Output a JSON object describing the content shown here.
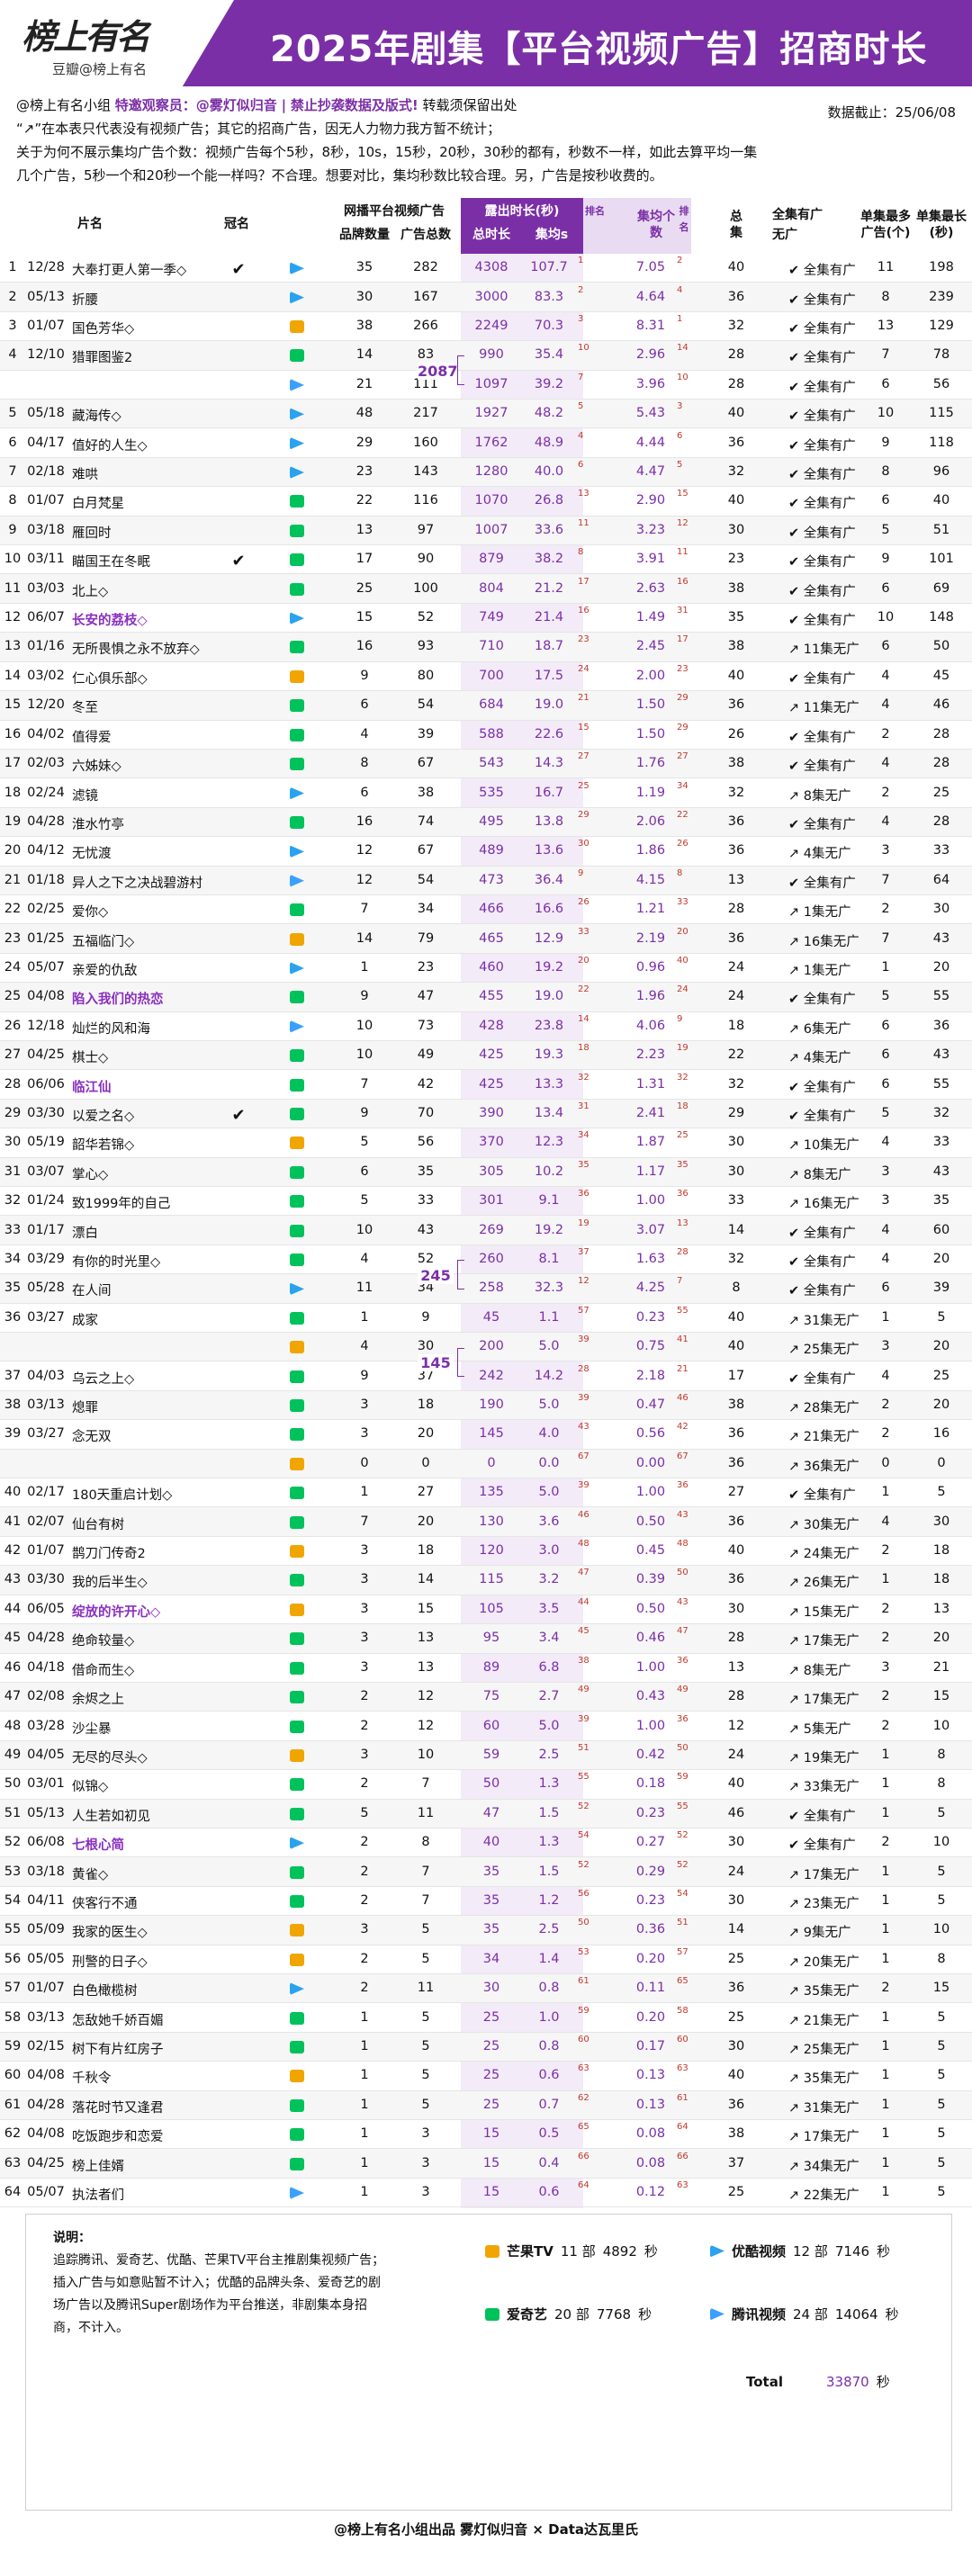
{
  "header": {
    "logo": "榜上有名",
    "logo_sub": "豆瓣@榜上有名",
    "title": "2025年剧集【平台视频广告】招商时长"
  },
  "notes": {
    "line1a": "@榜上有名小组 ",
    "line1b": "特邀观察员：",
    "line1c": "@雾灯似归音",
    "line1d": "|",
    "line1e": "禁止抄袭数据及版式!",
    "line1f": " 转载须保留出处",
    "line2": "“↗”在本表只代表没有视频广告；其它的招商广告，因无人力物力我方暂不统计；",
    "line3": "关于为何不展示集均广告个数：视频广告每个5秒，8秒，10s，15秒，20秒，30秒的都有，秒数不一样，如此去算平均一集",
    "line4": "几个广告，5秒一个和20秒一个能一样吗？不合理。想要对比，集均秒数比较合理。另，广告是按秒收费的。"
  },
  "date": "数据截止：25/06/08",
  "columns": {
    "name": "片名",
    "crown": "冠名",
    "group": "网播平台视频广告",
    "brands": "品牌数量",
    "ads": "广告总数",
    "expo": "露出时长(秒)",
    "total": "总时长",
    "per_ep": "集均s",
    "rank": "排名",
    "avg_cnt": "集均个数",
    "eps": "总集",
    "full": "全集有广",
    "none": "无广",
    "max_ads": "单集最多广告(个)",
    "max_sec": "单集最长(秒)"
  },
  "rows": [
    [
      "1",
      "12/28",
      "大奉打更人第一季◇",
      "✔",
      "yk",
      "35",
      "282",
      "4308",
      "107.7",
      "1",
      "7.05",
      "2",
      "40",
      "全集有广",
      "11",
      "198"
    ],
    [
      "2",
      "05/13",
      "折腰",
      "",
      "yk",
      "30",
      "167",
      "3000",
      "83.3",
      "2",
      "4.64",
      "4",
      "36",
      "全集有广",
      "8",
      "239"
    ],
    [
      "3",
      "01/07",
      "国色芳华◇",
      "",
      "mg",
      "38",
      "266",
      "2249",
      "70.3",
      "3",
      "8.31",
      "1",
      "32",
      "全集有广",
      "13",
      "129"
    ],
    [
      "4",
      "12/10",
      "猎罪图鉴2",
      "",
      "aqy",
      "14",
      "83",
      "990",
      "35.4",
      "10",
      "2.96",
      "14",
      "28",
      "全集有广",
      "7",
      "78"
    ],
    [
      "",
      "",
      "",
      "",
      "tx",
      "21",
      "111",
      "1097",
      "39.2",
      "7",
      "3.96",
      "10",
      "28",
      "全集有广",
      "6",
      "56"
    ],
    [
      "5",
      "05/18",
      "藏海传◇",
      "",
      "yk",
      "48",
      "217",
      "1927",
      "48.2",
      "5",
      "5.43",
      "3",
      "40",
      "全集有广",
      "10",
      "115"
    ],
    [
      "6",
      "04/17",
      "值好的人生◇",
      "",
      "yk",
      "29",
      "160",
      "1762",
      "48.9",
      "4",
      "4.44",
      "6",
      "36",
      "全集有广",
      "9",
      "118"
    ],
    [
      "7",
      "02/18",
      "难哄",
      "",
      "yk",
      "23",
      "143",
      "1280",
      "40.0",
      "6",
      "4.47",
      "5",
      "32",
      "全集有广",
      "8",
      "96"
    ],
    [
      "8",
      "01/07",
      "白月梵星",
      "",
      "aqy",
      "22",
      "116",
      "1070",
      "26.8",
      "13",
      "2.90",
      "15",
      "40",
      "全集有广",
      "6",
      "40"
    ],
    [
      "9",
      "03/18",
      "雁回时",
      "",
      "aqy",
      "13",
      "97",
      "1007",
      "33.6",
      "11",
      "3.23",
      "12",
      "30",
      "全集有广",
      "5",
      "51"
    ],
    [
      "10",
      "03/11",
      "瞄国王在冬眠",
      "✔",
      "aqy",
      "17",
      "90",
      "879",
      "38.2",
      "8",
      "3.91",
      "11",
      "23",
      "全集有广",
      "9",
      "101"
    ],
    [
      "11",
      "03/03",
      "北上◇",
      "",
      "aqy",
      "25",
      "100",
      "804",
      "21.2",
      "17",
      "2.63",
      "16",
      "38",
      "全集有广",
      "6",
      "69"
    ],
    [
      "12",
      "06/07",
      "长安的荔枝◇",
      "",
      "yk",
      "15",
      "52",
      "749",
      "21.4",
      "16",
      "1.49",
      "31",
      "35",
      "全集有广",
      "10",
      "148"
    ],
    [
      "13",
      "01/16",
      "无所畏惧之永不放弃◇",
      "",
      "aqy",
      "16",
      "93",
      "710",
      "18.7",
      "23",
      "2.45",
      "17",
      "38",
      "11集无广",
      "6",
      "50"
    ],
    [
      "14",
      "03/02",
      "仁心俱乐部◇",
      "",
      "mg",
      "9",
      "80",
      "700",
      "17.5",
      "24",
      "2.00",
      "23",
      "40",
      "全集有广",
      "4",
      "45"
    ],
    [
      "15",
      "12/20",
      "冬至",
      "",
      "aqy",
      "6",
      "54",
      "684",
      "19.0",
      "21",
      "1.50",
      "29",
      "36",
      "11集无广",
      "4",
      "46"
    ],
    [
      "16",
      "04/02",
      "值得爱",
      "",
      "aqy",
      "4",
      "39",
      "588",
      "22.6",
      "15",
      "1.50",
      "29",
      "26",
      "全集有广",
      "2",
      "28"
    ],
    [
      "17",
      "02/03",
      "六姊妹◇",
      "",
      "aqy",
      "8",
      "67",
      "543",
      "14.3",
      "27",
      "1.76",
      "27",
      "38",
      "全集有广",
      "4",
      "28"
    ],
    [
      "18",
      "02/24",
      "滤镜",
      "",
      "yk",
      "6",
      "38",
      "535",
      "16.7",
      "25",
      "1.19",
      "34",
      "32",
      "8集无广",
      "2",
      "25"
    ],
    [
      "19",
      "04/28",
      "淮水竹亭",
      "",
      "aqy",
      "16",
      "74",
      "495",
      "13.8",
      "29",
      "2.06",
      "22",
      "36",
      "全集有广",
      "4",
      "28"
    ],
    [
      "20",
      "04/12",
      "无忧渡",
      "",
      "yk",
      "12",
      "67",
      "489",
      "13.6",
      "30",
      "1.86",
      "26",
      "36",
      "4集无广",
      "3",
      "33"
    ],
    [
      "21",
      "01/18",
      "异人之下之决战碧游村",
      "",
      "tx",
      "12",
      "54",
      "473",
      "36.4",
      "9",
      "4.15",
      "8",
      "13",
      "全集有广",
      "7",
      "64"
    ],
    [
      "22",
      "02/25",
      "爱你◇",
      "",
      "aqy",
      "7",
      "34",
      "466",
      "16.6",
      "26",
      "1.21",
      "33",
      "28",
      "1集无广",
      "2",
      "30"
    ],
    [
      "23",
      "01/25",
      "五福临门◇",
      "",
      "mg",
      "14",
      "79",
      "465",
      "12.9",
      "33",
      "2.19",
      "20",
      "36",
      "16集无广",
      "7",
      "43"
    ],
    [
      "24",
      "05/07",
      "亲爱的仇敌",
      "",
      "yk",
      "1",
      "23",
      "460",
      "19.2",
      "20",
      "0.96",
      "40",
      "24",
      "1集无广",
      "1",
      "20"
    ],
    [
      "25",
      "04/08",
      "陷入我们的热恋",
      "",
      "aqy",
      "9",
      "47",
      "455",
      "19.0",
      "22",
      "1.96",
      "24",
      "24",
      "全集有广",
      "5",
      "55"
    ],
    [
      "26",
      "12/18",
      "灿烂的风和海",
      "",
      "tx",
      "10",
      "73",
      "428",
      "23.8",
      "14",
      "4.06",
      "9",
      "18",
      "6集无广",
      "6",
      "36"
    ],
    [
      "27",
      "04/25",
      "棋士◇",
      "",
      "aqy",
      "10",
      "49",
      "425",
      "19.3",
      "18",
      "2.23",
      "19",
      "22",
      "4集无广",
      "6",
      "43"
    ],
    [
      "28",
      "06/06",
      "临江仙",
      "",
      "aqy",
      "7",
      "42",
      "425",
      "13.3",
      "32",
      "1.31",
      "32",
      "32",
      "全集有广",
      "6",
      "55"
    ],
    [
      "29",
      "03/30",
      "以爱之名◇",
      "✔",
      "aqy",
      "9",
      "70",
      "390",
      "13.4",
      "31",
      "2.41",
      "18",
      "29",
      "全集有广",
      "5",
      "32"
    ],
    [
      "30",
      "05/19",
      "韶华若锦◇",
      "",
      "mg",
      "5",
      "56",
      "370",
      "12.3",
      "34",
      "1.87",
      "25",
      "30",
      "10集无广",
      "4",
      "33"
    ],
    [
      "31",
      "03/07",
      "掌心◇",
      "",
      "aqy",
      "6",
      "35",
      "305",
      "10.2",
      "35",
      "1.17",
      "35",
      "30",
      "8集无广",
      "3",
      "43"
    ],
    [
      "32",
      "01/24",
      "致1999年的自己",
      "",
      "aqy",
      "5",
      "33",
      "301",
      "9.1",
      "36",
      "1.00",
      "36",
      "33",
      "16集无广",
      "3",
      "35"
    ],
    [
      "33",
      "01/17",
      "漂白",
      "",
      "aqy",
      "10",
      "43",
      "269",
      "19.2",
      "19",
      "3.07",
      "13",
      "14",
      "全集有广",
      "4",
      "60"
    ],
    [
      "34",
      "03/29",
      "有你的时光里◇",
      "",
      "aqy",
      "4",
      "52",
      "260",
      "8.1",
      "37",
      "1.63",
      "28",
      "32",
      "全集有广",
      "4",
      "20"
    ],
    [
      "35",
      "05/28",
      "在人间",
      "",
      "yk",
      "11",
      "34",
      "258",
      "32.3",
      "12",
      "4.25",
      "7",
      "8",
      "全集有广",
      "6",
      "39"
    ],
    [
      "36",
      "03/27",
      "成家",
      "",
      "aqy",
      "1",
      "9",
      "45",
      "1.1",
      "57",
      "0.23",
      "55",
      "40",
      "31集无广",
      "1",
      "5"
    ],
    [
      "",
      "",
      "",
      "",
      "mg",
      "4",
      "30",
      "200",
      "5.0",
      "39",
      "0.75",
      "41",
      "40",
      "25集无广",
      "3",
      "20"
    ],
    [
      "37",
      "04/03",
      "乌云之上◇",
      "",
      "aqy",
      "9",
      "37",
      "242",
      "14.2",
      "28",
      "2.18",
      "21",
      "17",
      "全集有广",
      "4",
      "25"
    ],
    [
      "38",
      "03/13",
      "熄罪",
      "",
      "aqy",
      "3",
      "18",
      "190",
      "5.0",
      "39",
      "0.47",
      "46",
      "38",
      "28集无广",
      "2",
      "20"
    ],
    [
      "39",
      "03/27",
      "念无双",
      "",
      "aqy",
      "3",
      "20",
      "145",
      "4.0",
      "43",
      "0.56",
      "42",
      "36",
      "21集无广",
      "2",
      "16"
    ],
    [
      "",
      "",
      "",
      "",
      "mg",
      "0",
      "0",
      "0",
      "0.0",
      "67",
      "0.00",
      "67",
      "36",
      "36集无广",
      "0",
      "0"
    ],
    [
      "40",
      "02/17",
      "180天重启计划◇",
      "",
      "aqy",
      "1",
      "27",
      "135",
      "5.0",
      "39",
      "1.00",
      "36",
      "27",
      "全集有广",
      "1",
      "5"
    ],
    [
      "41",
      "02/07",
      "仙台有树",
      "",
      "aqy",
      "7",
      "20",
      "130",
      "3.6",
      "46",
      "0.50",
      "43",
      "36",
      "30集无广",
      "4",
      "30"
    ],
    [
      "42",
      "01/07",
      "鹊刀门传奇2",
      "",
      "mg",
      "3",
      "18",
      "120",
      "3.0",
      "48",
      "0.45",
      "48",
      "40",
      "24集无广",
      "2",
      "18"
    ],
    [
      "43",
      "03/30",
      "我的后半生◇",
      "",
      "aqy",
      "3",
      "14",
      "115",
      "3.2",
      "47",
      "0.39",
      "50",
      "36",
      "26集无广",
      "1",
      "18"
    ],
    [
      "44",
      "06/05",
      "绽放的许开心◇",
      "",
      "mg",
      "3",
      "15",
      "105",
      "3.5",
      "44",
      "0.50",
      "43",
      "30",
      "15集无广",
      "2",
      "13"
    ],
    [
      "45",
      "04/28",
      "绝命较量◇",
      "",
      "aqy",
      "3",
      "13",
      "95",
      "3.4",
      "45",
      "0.46",
      "47",
      "28",
      "17集无广",
      "2",
      "20"
    ],
    [
      "46",
      "04/18",
      "借命而生◇",
      "",
      "aqy",
      "3",
      "13",
      "89",
      "6.8",
      "38",
      "1.00",
      "36",
      "13",
      "8集无广",
      "3",
      "21"
    ],
    [
      "47",
      "02/08",
      "余烬之上",
      "",
      "aqy",
      "2",
      "12",
      "75",
      "2.7",
      "49",
      "0.43",
      "49",
      "28",
      "17集无广",
      "2",
      "15"
    ],
    [
      "48",
      "03/28",
      "沙尘暴",
      "",
      "aqy",
      "2",
      "12",
      "60",
      "5.0",
      "39",
      "1.00",
      "36",
      "12",
      "5集无广",
      "2",
      "10"
    ],
    [
      "49",
      "04/05",
      "无尽的尽头◇",
      "",
      "mg",
      "3",
      "10",
      "59",
      "2.5",
      "51",
      "0.42",
      "50",
      "24",
      "19集无广",
      "1",
      "8"
    ],
    [
      "50",
      "03/01",
      "似锦◇",
      "",
      "aqy",
      "2",
      "7",
      "50",
      "1.3",
      "55",
      "0.18",
      "59",
      "40",
      "33集无广",
      "1",
      "8"
    ],
    [
      "51",
      "05/13",
      "人生若如初见",
      "",
      "aqy",
      "5",
      "11",
      "47",
      "1.5",
      "52",
      "0.23",
      "55",
      "46",
      "全集有广",
      "1",
      "5"
    ],
    [
      "52",
      "06/08",
      "七根心简",
      "",
      "yk",
      "2",
      "8",
      "40",
      "1.3",
      "54",
      "0.27",
      "52",
      "30",
      "全集有广",
      "2",
      "10"
    ],
    [
      "53",
      "03/18",
      "黄雀◇",
      "",
      "aqy",
      "2",
      "7",
      "35",
      "1.5",
      "52",
      "0.29",
      "52",
      "24",
      "17集无广",
      "1",
      "5"
    ],
    [
      "54",
      "04/11",
      "侠客行不通",
      "",
      "aqy",
      "2",
      "7",
      "35",
      "1.2",
      "56",
      "0.23",
      "54",
      "30",
      "23集无广",
      "1",
      "5"
    ],
    [
      "55",
      "05/09",
      "我家的医生◇",
      "",
      "mg",
      "3",
      "5",
      "35",
      "2.5",
      "50",
      "0.36",
      "51",
      "14",
      "9集无广",
      "1",
      "10"
    ],
    [
      "56",
      "05/05",
      "刑警的日子◇",
      "",
      "mg",
      "2",
      "5",
      "34",
      "1.4",
      "53",
      "0.20",
      "57",
      "25",
      "20集无广",
      "1",
      "8"
    ],
    [
      "57",
      "01/07",
      "白色橄榄树",
      "",
      "yk",
      "2",
      "11",
      "30",
      "0.8",
      "61",
      "0.11",
      "65",
      "36",
      "35集无广",
      "2",
      "15"
    ],
    [
      "58",
      "03/13",
      "怎敌她千娇百媚",
      "",
      "aqy",
      "1",
      "5",
      "25",
      "1.0",
      "59",
      "0.20",
      "58",
      "25",
      "21集无广",
      "1",
      "5"
    ],
    [
      "59",
      "02/15",
      "树下有片红房子",
      "",
      "aqy",
      "1",
      "5",
      "25",
      "0.8",
      "60",
      "0.17",
      "60",
      "30",
      "25集无广",
      "1",
      "5"
    ],
    [
      "60",
      "04/08",
      "千秋令",
      "",
      "mg",
      "1",
      "5",
      "25",
      "0.6",
      "63",
      "0.13",
      "63",
      "40",
      "35集无广",
      "1",
      "5"
    ],
    [
      "61",
      "04/28",
      "落花时节又逢君",
      "",
      "aqy",
      "1",
      "5",
      "25",
      "0.7",
      "62",
      "0.13",
      "61",
      "36",
      "31集无广",
      "1",
      "5"
    ],
    [
      "62",
      "04/08",
      "吃饭跑步和恋爱",
      "",
      "aqy",
      "1",
      "3",
      "15",
      "0.5",
      "65",
      "0.08",
      "64",
      "38",
      "17集无广",
      "1",
      "5"
    ],
    [
      "63",
      "04/25",
      "榜上佳婿",
      "",
      "aqy",
      "1",
      "3",
      "15",
      "0.4",
      "66",
      "0.08",
      "66",
      "37",
      "34集无广",
      "1",
      "5"
    ],
    [
      "64",
      "05/07",
      "执法者们",
      "",
      "tx",
      "1",
      "3",
      "15",
      "0.6",
      "64",
      "0.12",
      "63",
      "25",
      "22集无广",
      "1",
      "5"
    ]
  ],
  "highlight_names": [
    "长安的荔枝◇",
    "陷入我们的热恋",
    "临江仙",
    "绽放的许开心◇",
    "七根心简"
  ],
  "merged_totals": [
    {
      "start": 3,
      "value": "2087"
    },
    {
      "start": 34,
      "value": "245"
    },
    {
      "start": 37,
      "value": "145"
    }
  ],
  "platform_colors": {
    "yk": "#2aa3ef",
    "aqy": "#00c25a",
    "mg": "#f0a500",
    "tx": "#3aa0ff"
  },
  "footer": {
    "title": "说明：",
    "text": "追踪腾讯、爱奇艺、优酷、芒果TV平台主推剧集视频广告；插入广告与如意贴暂不计入；优酷的品牌头条、爱奇艺的剧场广告以及腾讯Super剧场作为平台推送，非剧集本身招商，不计入。",
    "platforms": [
      {
        "icon": "mg",
        "name": "芒果TV",
        "count": "11 部",
        "sec": "4892",
        "unit": "秒"
      },
      {
        "icon": "yk",
        "name": "优酷视频",
        "count": "12 部",
        "sec": "7146",
        "unit": "秒"
      },
      {
        "icon": "aqy",
        "name": "爱奇艺",
        "count": "20 部",
        "sec": "7768",
        "unit": "秒"
      },
      {
        "icon": "tx",
        "name": "腾讯视频",
        "count": "24 部",
        "sec": "14064",
        "unit": "秒"
      }
    ],
    "total_label": "Total",
    "total_value": "33870",
    "total_unit": "秒"
  },
  "bottom": "@榜上有名小组出品  雾灯似归音 × Data达瓦里氏"
}
